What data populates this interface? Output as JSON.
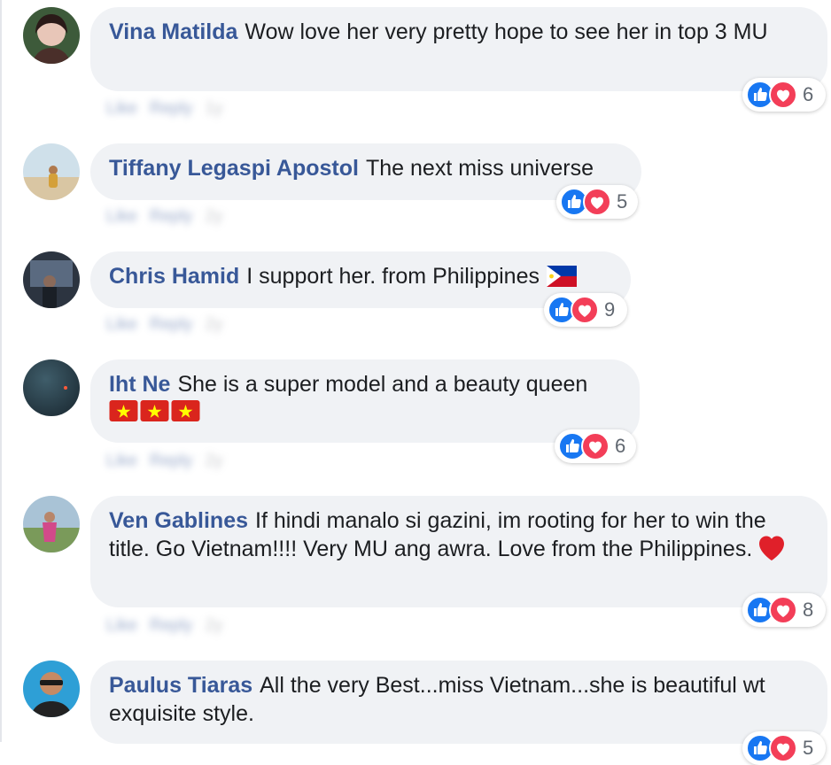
{
  "comments": [
    {
      "author": "Vina Matilda",
      "text": "Wow love her very pretty hope to see her in top 3 MU",
      "reaction_count": "6",
      "actions": {
        "like": "Like",
        "reply": "Reply",
        "time": "1y"
      }
    },
    {
      "author": "Tiffany Legaspi Apostol",
      "text": "The next miss universe",
      "reaction_count": "5",
      "actions": {
        "like": "Like",
        "reply": "Reply",
        "time": "2y"
      }
    },
    {
      "author": "Chris Hamid",
      "text": "I support her. from Philippines",
      "reaction_count": "9",
      "actions": {
        "like": "Like",
        "reply": "Reply",
        "time": "2y"
      }
    },
    {
      "author": "Iht Ne",
      "text": "She is a super model and a beauty queen",
      "reaction_count": "6",
      "actions": {
        "like": "Like",
        "reply": "Reply",
        "time": "2y"
      }
    },
    {
      "author": "Ven Gablines",
      "text": "If hindi manalo si gazini, im rooting for her to win the title. Go Vietnam!!!! Very MU ang awra. Love from the Philippines.",
      "reaction_count": "8",
      "actions": {
        "like": "Like",
        "reply": "Reply",
        "time": "2y"
      }
    },
    {
      "author": "Paulus Tiaras",
      "text": "All the very Best...miss Vietnam...she is beautiful wt exquisite style.",
      "reaction_count": "5"
    }
  ],
  "icons": {
    "like": "thumbs-up-icon",
    "love": "heart-icon",
    "flag_ph": "philippines-flag-icon",
    "flag_vn": "vietnam-flag-icon"
  },
  "colors": {
    "author": "#385898",
    "bubble": "#f0f2f5",
    "like_blue": "#1877f2",
    "love_red": "#f33e58"
  }
}
